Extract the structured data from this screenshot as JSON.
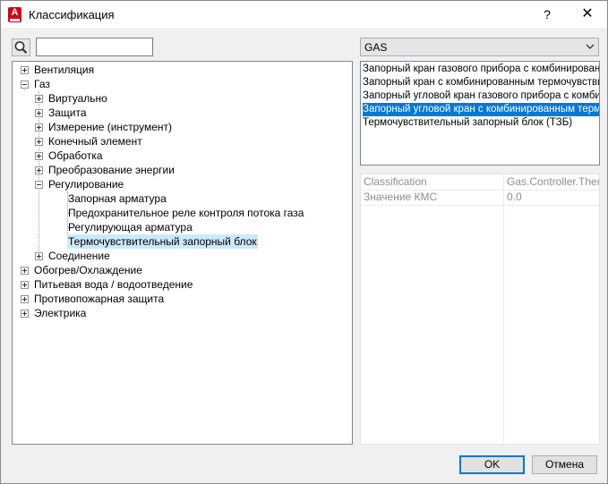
{
  "window": {
    "title": "Классификация",
    "help_glyph": "?",
    "close_glyph": "✕",
    "app_icon_letter": "A"
  },
  "search": {
    "value": "",
    "placeholder": ""
  },
  "tree": [
    {
      "label": "Вентиляция",
      "expander": "plus"
    },
    {
      "label": "Газ",
      "expander": "minus"
    },
    {
      "label": "Виртуально",
      "expander": "plus"
    },
    {
      "label": "Защита",
      "expander": "plus"
    },
    {
      "label": "Измерение (инструмент)",
      "expander": "plus"
    },
    {
      "label": "Конечный элемент",
      "expander": "plus"
    },
    {
      "label": "Обработка",
      "expander": "plus"
    },
    {
      "label": "Преобразование энергии",
      "expander": "plus"
    },
    {
      "label": "Регулирование",
      "expander": "minus"
    },
    {
      "label": "Запорная арматура",
      "expander": "none"
    },
    {
      "label": "Предохранительное реле контроля потока газа",
      "expander": "none"
    },
    {
      "label": "Регулирующая арматура",
      "expander": "none"
    },
    {
      "label": "Термочувствительный запорный блок",
      "expander": "none",
      "selected": true
    },
    {
      "label": "Соединение",
      "expander": "plus"
    },
    {
      "label": "Обогрев/Охлаждение",
      "expander": "plus"
    },
    {
      "label": "Питьевая вода / водоотведение",
      "expander": "plus"
    },
    {
      "label": "Противопожарная защита",
      "expander": "plus"
    },
    {
      "label": "Электрика",
      "expander": "plus"
    }
  ],
  "system_select": {
    "value": "GAS"
  },
  "items": [
    {
      "label": "Запорный кран газового прибора с комбинированн"
    },
    {
      "label": "Запорный кран с комбинированным термочувствит"
    },
    {
      "label": "Запорный угловой кран газового прибора с комбин"
    },
    {
      "label": "Запорный угловой кран с комбинированным термо",
      "selected": true
    },
    {
      "label": "Термочувствительный запорный блок (ТЗБ)"
    }
  ],
  "properties": [
    {
      "name": "Classification",
      "value": "Gas.Controller.Ther..."
    },
    {
      "name": "Значение КМС",
      "value": "0.0"
    }
  ],
  "buttons": {
    "ok": "OK",
    "cancel": "Отмена"
  },
  "colors": {
    "selection": "#0078d7",
    "tree_selection": "#cce8ff",
    "app_icon": "#d1001a"
  }
}
